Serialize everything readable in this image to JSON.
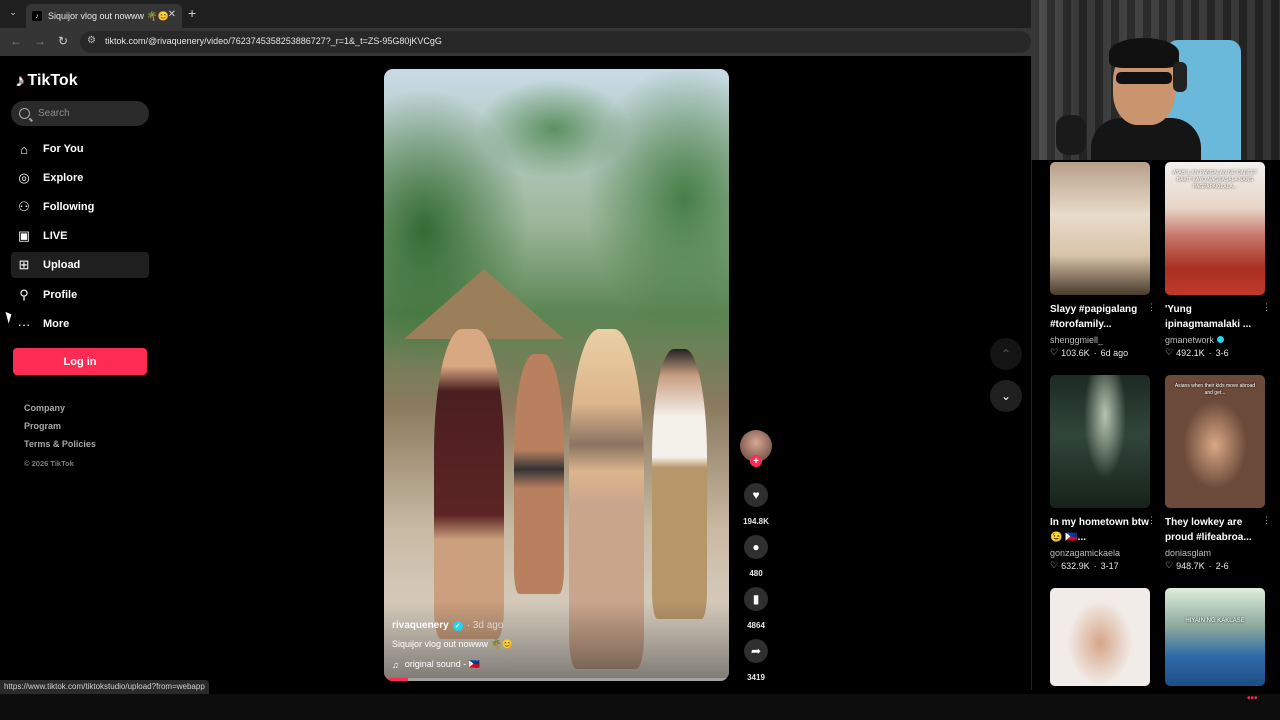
{
  "browser": {
    "tab_title": "Siquijor vlog out nowww 🌴😊",
    "url": "tiktok.com/@rivaquenery/video/7623745358253886727?_r=1&_t=ZS-95G80jKVCgG",
    "status_url": "https://www.tiktok.com/tiktokstudio/upload?from=webapp"
  },
  "sidebar": {
    "logo": "TikTok",
    "search_placeholder": "Search",
    "items": [
      {
        "label": "For You",
        "icon": "home-icon"
      },
      {
        "label": "Explore",
        "icon": "compass-icon"
      },
      {
        "label": "Following",
        "icon": "user-plus-icon"
      },
      {
        "label": "LIVE",
        "icon": "live-tv-icon"
      },
      {
        "label": "Upload",
        "icon": "upload-icon"
      },
      {
        "label": "Profile",
        "icon": "user-icon"
      },
      {
        "label": "More",
        "icon": "more-dots-icon"
      }
    ],
    "login_label": "Log in",
    "footer": {
      "company": "Company",
      "program": "Program",
      "terms": "Terms & Policies",
      "copyright": "© 2026 TikTok"
    }
  },
  "video": {
    "author": "rivaquenery",
    "date": "· 3d ago",
    "caption": "Siquijor vlog out nowww 🌴😊",
    "sound": "original sound - 🇵🇭",
    "progress": 0.07,
    "likes": "194.8K",
    "comments": "480",
    "saves": "4864",
    "shares": "3419"
  },
  "recommendations": [
    {
      "title": "Slayy #papigalang #torofamily...",
      "author": "shenggmiell_",
      "views": "103.6K",
      "date": "6d ago",
      "verified": false
    },
    {
      "title": "'Yung ipinagmamalaki ...",
      "author": "gmanetwork",
      "views": "492.1K",
      "date": "3-6",
      "verified": true,
      "thumb_text": "ATAB IL AN PANGALAN NG DANCE? BAKIT KAYO NAGKASALA NANG PAGPAPAKILALA..."
    },
    {
      "title": "In my hometown btw😉 🇵🇭...",
      "author": "gonzagamickaela",
      "views": "632.9K",
      "date": "3-17",
      "verified": false
    },
    {
      "title": "They lowkey are proud #lifeabroa...",
      "author": "doniasglam",
      "views": "948.7K",
      "date": "2-6",
      "verified": false,
      "thumb_text": "Asians when their kids move abroad and get..."
    },
    {
      "title": "",
      "author": "",
      "views": "",
      "date": "",
      "verified": false
    },
    {
      "title": "",
      "author": "",
      "views": "",
      "date": "",
      "verified": false,
      "thumb_text": "HIYAIN NG KAKLASE"
    }
  ]
}
